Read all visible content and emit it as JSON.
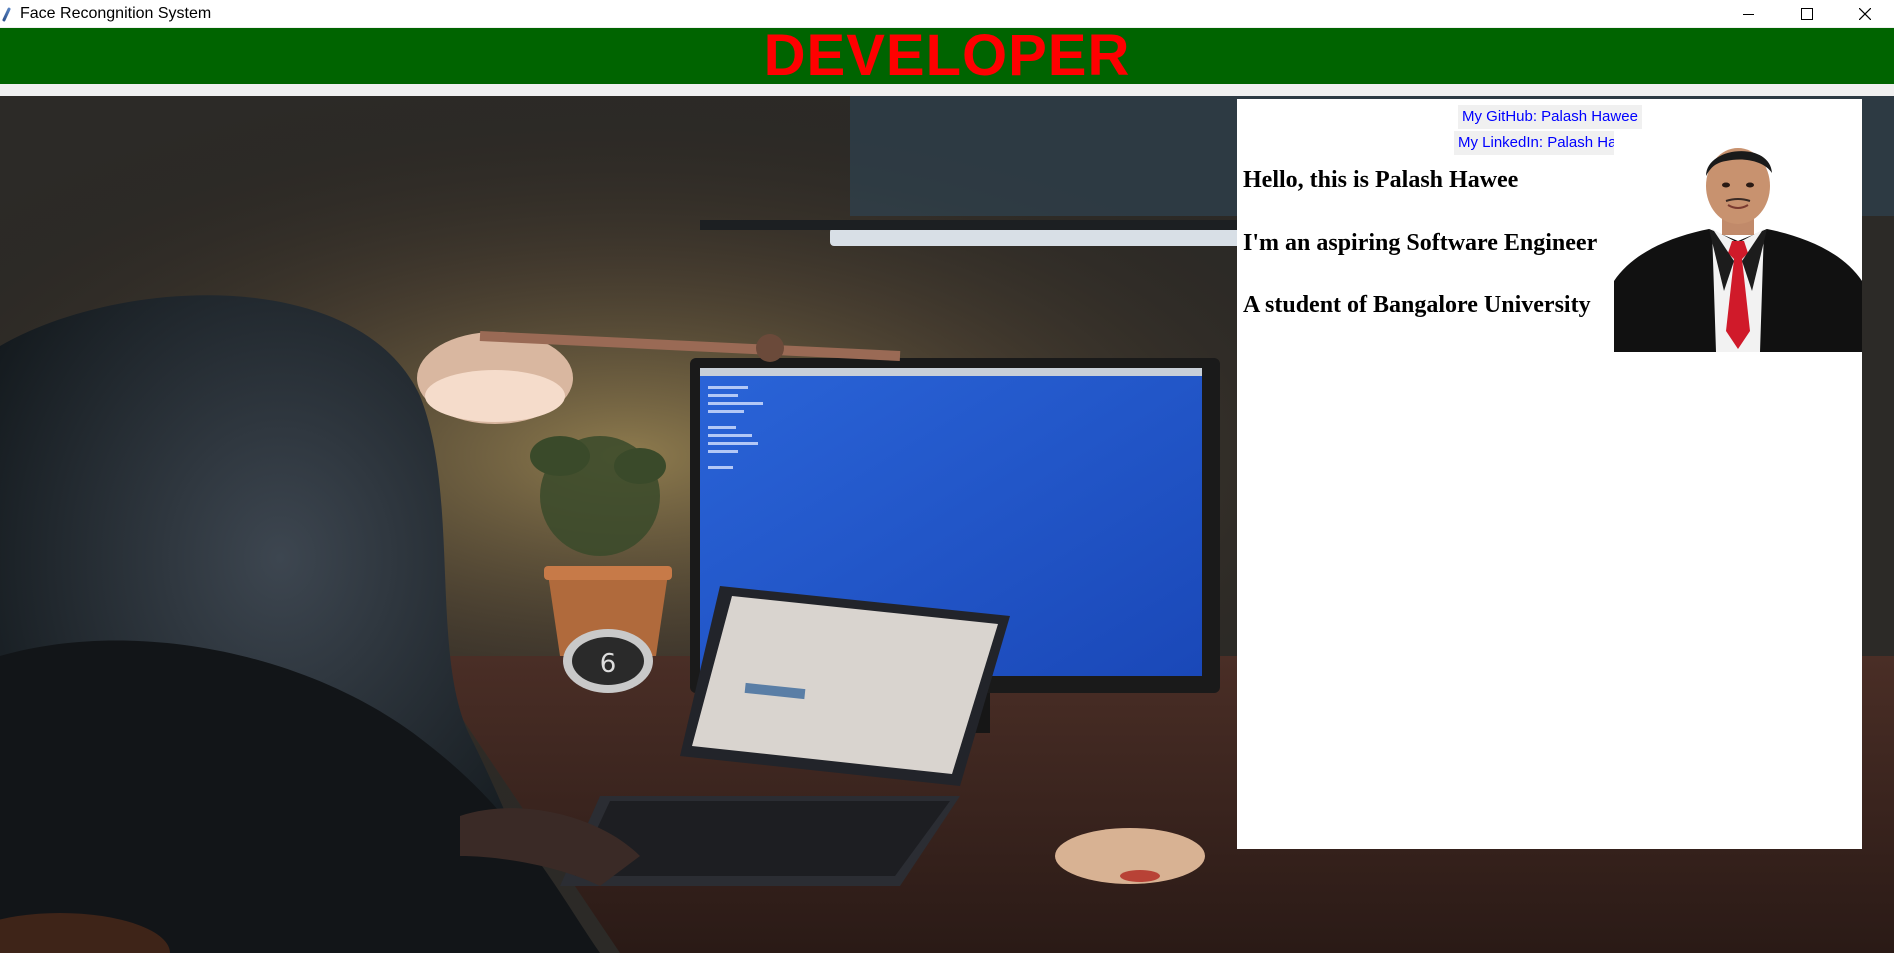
{
  "window": {
    "title": "Face Recongnition System",
    "controls": {
      "minimize": "minimize-icon",
      "maximize": "maximize-icon",
      "close": "close-icon"
    }
  },
  "banner": {
    "title": "DEVELOPER",
    "bg_color": "#006400",
    "text_color": "#ff0000"
  },
  "panel": {
    "links": {
      "github": "My GitHub: Palash Hawee",
      "linkedin": "My LinkedIn: Palash Hawee"
    },
    "lines": [
      "Hello, this is Palash Hawee",
      "I'm an aspiring Software Engineer",
      "A student of Bangalore University"
    ]
  },
  "background": {
    "clock_digit": "6"
  }
}
